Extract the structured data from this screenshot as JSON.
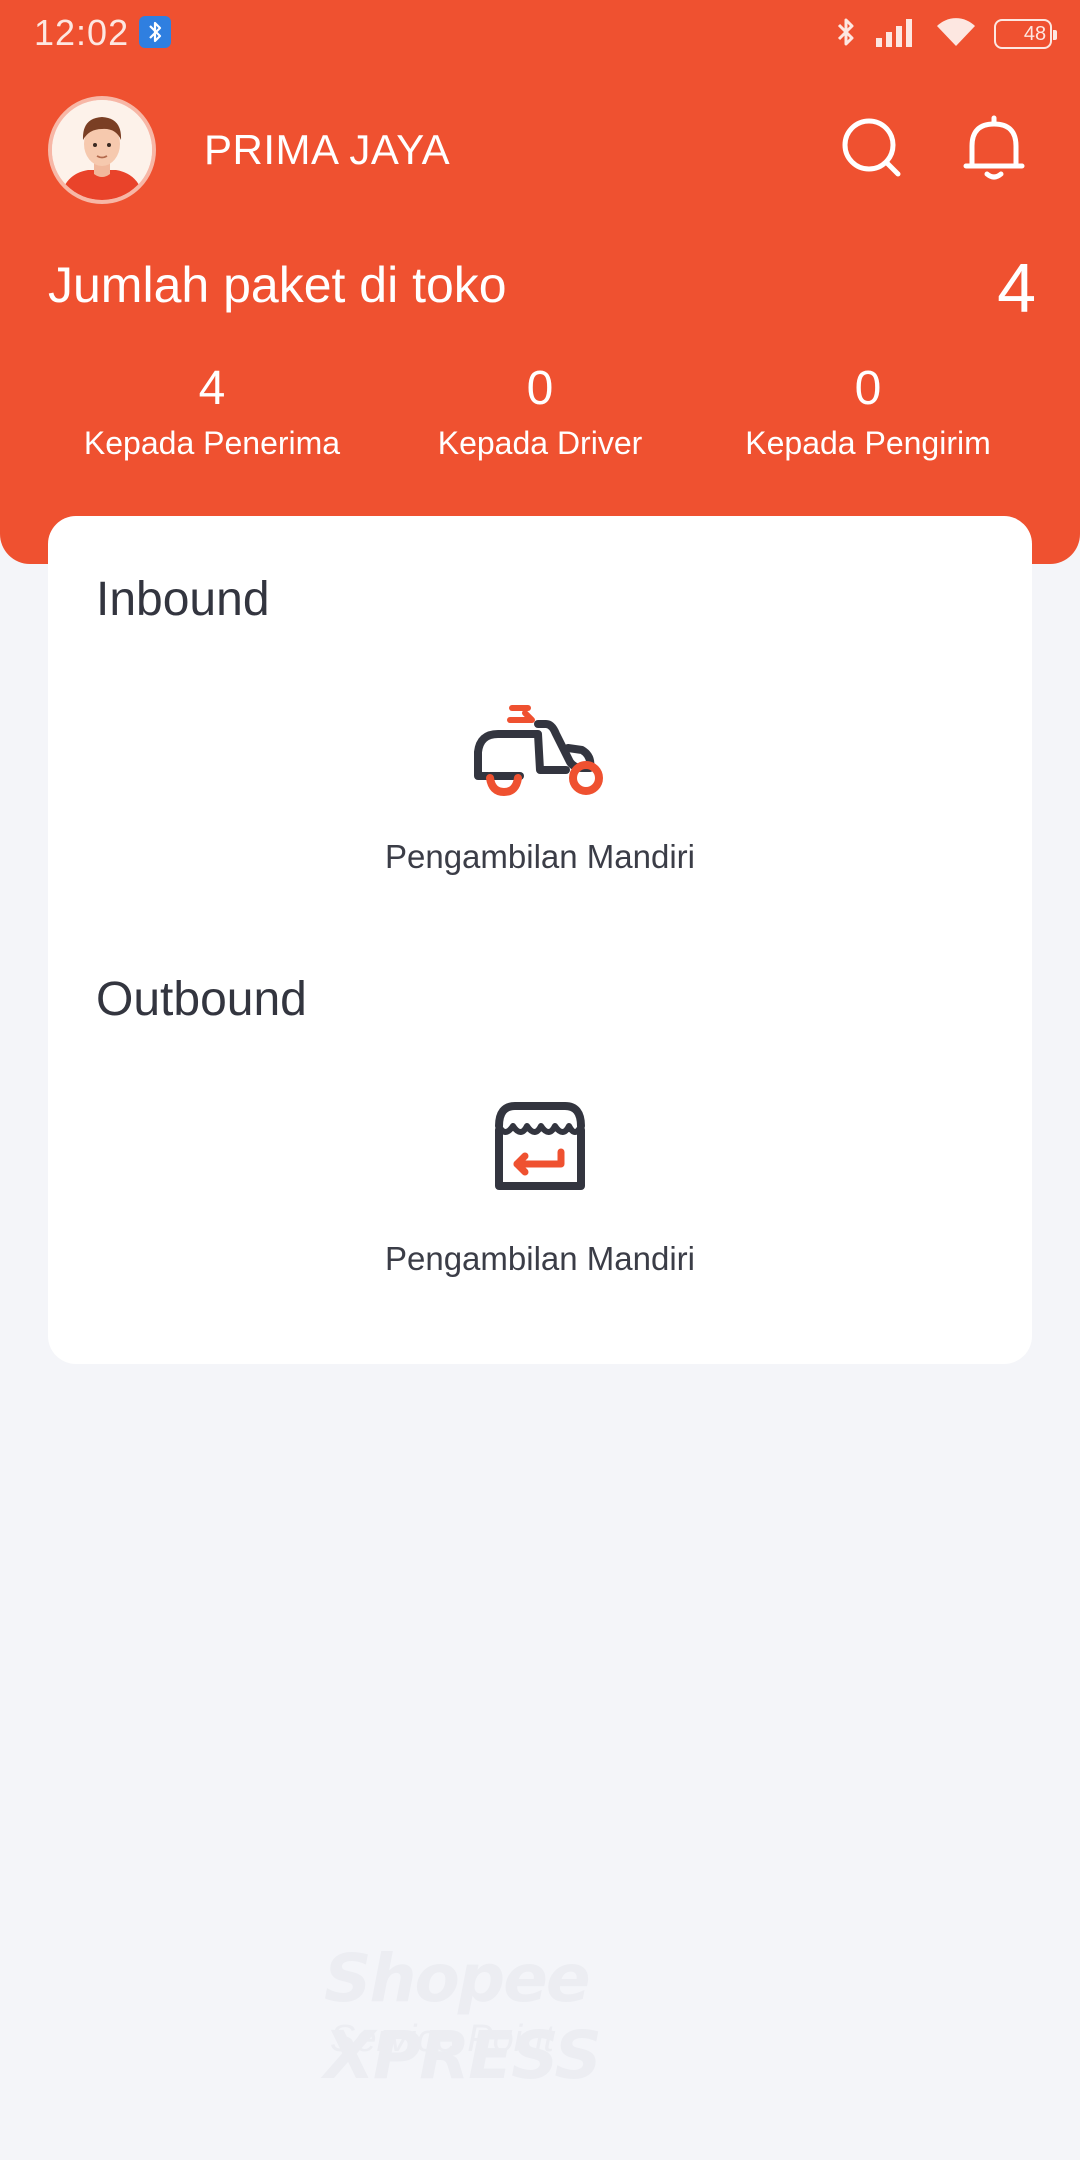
{
  "status_bar": {
    "time": "12:02",
    "battery_level": "48",
    "icons": [
      "bluetooth-icon",
      "signal-icon",
      "wifi-icon",
      "battery-icon"
    ]
  },
  "header": {
    "store_name": "PRIMA JAYA",
    "summary_label": "Jumlah paket di toko",
    "summary_count": "4",
    "stats": [
      {
        "value": "4",
        "label": "Kepada Penerima"
      },
      {
        "value": "0",
        "label": "Kepada Driver"
      },
      {
        "value": "0",
        "label": "Kepada Pengirim"
      }
    ]
  },
  "inbound": {
    "title": "Inbound",
    "tile_label": "Pengambilan Mandiri",
    "icon": "scooter-icon"
  },
  "outbound": {
    "title": "Outbound",
    "tile_label": "Pengambilan Mandiri",
    "icon": "store-icon"
  },
  "footer": {
    "brand": "Shopee XPRESS",
    "subtitle": "Service Point"
  },
  "colors": {
    "primary": "#ef5130",
    "background": "#f4f5f9",
    "icon_dark": "#33353f"
  }
}
